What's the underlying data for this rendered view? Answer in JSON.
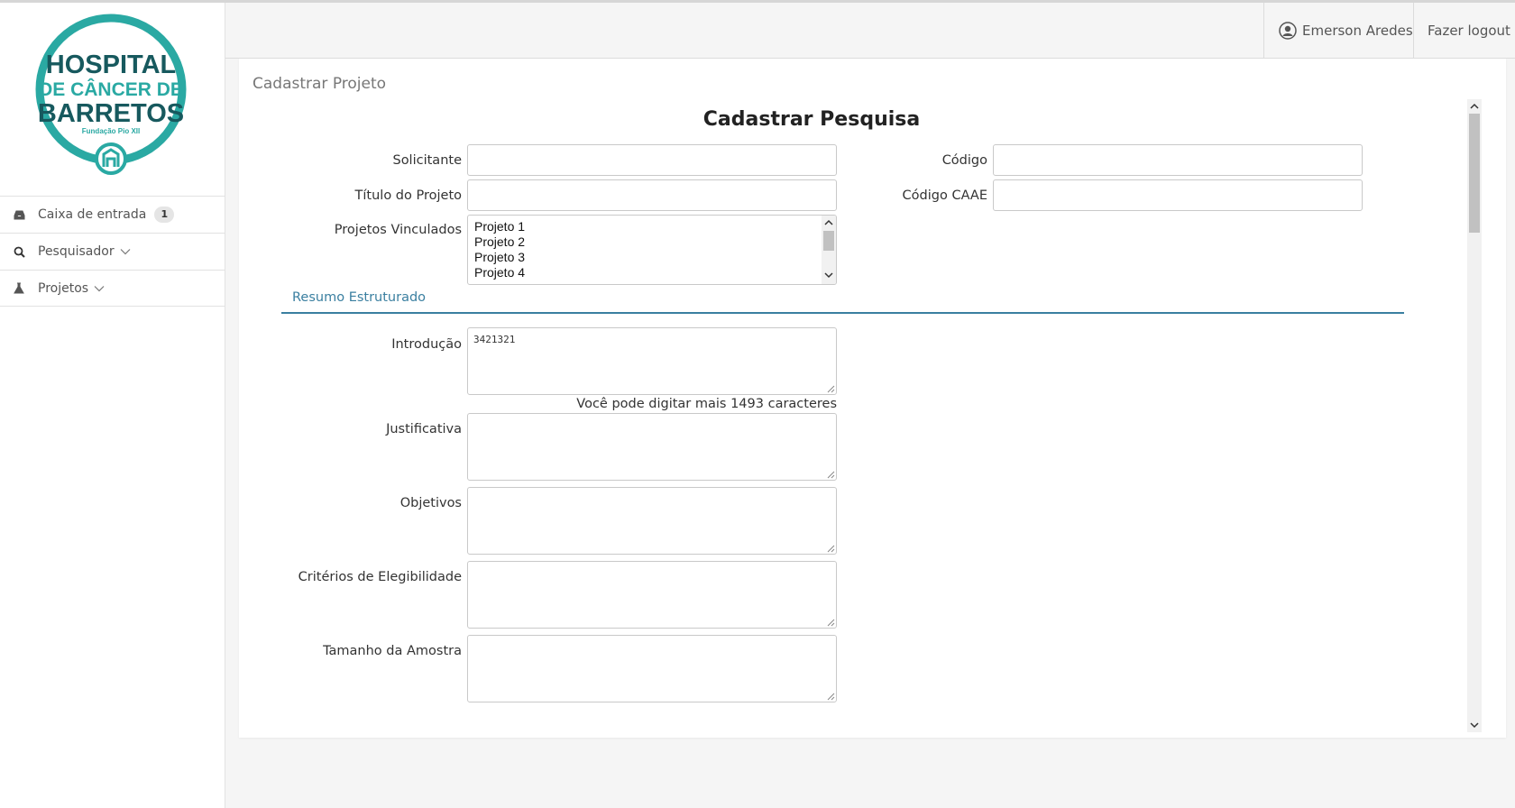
{
  "logo": {
    "line1": "HOSPITAL",
    "line2": "DE CÂNCER DE",
    "line3": "BARRETOS",
    "tagline": "Fundação Pio XII",
    "brand_color": "#2aa9a3"
  },
  "sidebar": {
    "items": [
      {
        "label": "Caixa de entrada",
        "badge": "1",
        "icon": "inbox-icon"
      },
      {
        "label": "Pesquisador",
        "icon": "search-icon"
      },
      {
        "label": "Projetos",
        "icon": "flask-icon"
      }
    ]
  },
  "header": {
    "user_name": "Emerson Aredes",
    "logout_label": "Fazer logout"
  },
  "page": {
    "breadcrumb": "Cadastrar Projeto",
    "form_title": "Cadastrar Pesquisa"
  },
  "form": {
    "solicitante_label": "Solicitante",
    "solicitante_value": "",
    "codigo_label": "Código",
    "codigo_value": "",
    "titulo_label": "Título do Projeto",
    "titulo_value": "",
    "caae_label": "Código CAAE",
    "caae_value": "",
    "vinculados_label": "Projetos Vinculados",
    "vinculados_options": [
      "Projeto 1",
      "Projeto 2",
      "Projeto 3",
      "Projeto 4"
    ],
    "section_title": "Resumo Estruturado",
    "introducao_label": "Introdução",
    "introducao_value": "3421321",
    "introducao_hint": "Você pode digitar mais 1493 caracteres",
    "justificativa_label": "Justificativa",
    "objetivos_label": "Objetivos",
    "criterios_label": "Critérios de Elegibilidade",
    "amostra_label": "Tamanho da Amostra"
  },
  "colors": {
    "accent": "#3a7fa0",
    "header_bg": "#f5f5f5"
  }
}
